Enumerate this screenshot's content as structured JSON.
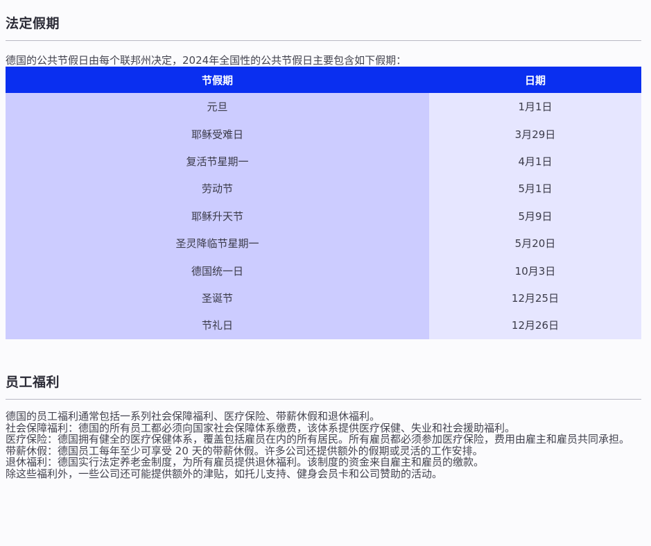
{
  "holidays_section": {
    "title": "法定假期",
    "intro": "德国的公共节假日由每个联邦州决定，2024年全国性的公共节假日主要包含如下假期：",
    "table": {
      "headers": [
        "节假期",
        "日期"
      ],
      "rows": [
        {
          "name": "元旦",
          "date": "1月1日"
        },
        {
          "name": "耶稣受难日",
          "date": "3月29日"
        },
        {
          "name": "复活节星期一",
          "date": "4月1日"
        },
        {
          "name": "劳动节",
          "date": "5月1日"
        },
        {
          "name": "耶稣升天节",
          "date": "5月9日"
        },
        {
          "name": "圣灵降临节星期一",
          "date": "5月20日"
        },
        {
          "name": "德国统一日",
          "date": "10月3日"
        },
        {
          "name": "圣诞节",
          "date": "12月25日"
        },
        {
          "name": "节礼日",
          "date": "12月26日"
        }
      ]
    }
  },
  "benefits_section": {
    "title": "员工福利",
    "paragraphs": [
      "德国的员工福利通常包括一系列社会保障福利、医疗保险、带薪休假和退休福利。",
      "社会保障福利：德国的所有员工都必须向国家社会保障体系缴费，该体系提供医疗保健、失业和社会援助福利。",
      "医疗保险：德国拥有健全的医疗保健体系，覆盖包括雇员在内的所有居民。所有雇员都必须参加医疗保险，费用由雇主和雇员共同承担。",
      "带薪休假：德国员工每年至少可享受 20 天的带薪休假。许多公司还提供额外的假期或灵活的工作安排。",
      "退休福利：德国实行法定养老金制度，为所有雇员提供退休福利。该制度的资金来自雇主和雇员的缴款。",
      "除这些福利外，一些公司还可能提供额外的津贴，如托儿支持、健身会员卡和公司赞助的活动。"
    ]
  },
  "colors": {
    "header_bg": "#0a2ff0",
    "name_col_bg": "#ccccff",
    "date_col_bg": "#e6e6ff"
  }
}
